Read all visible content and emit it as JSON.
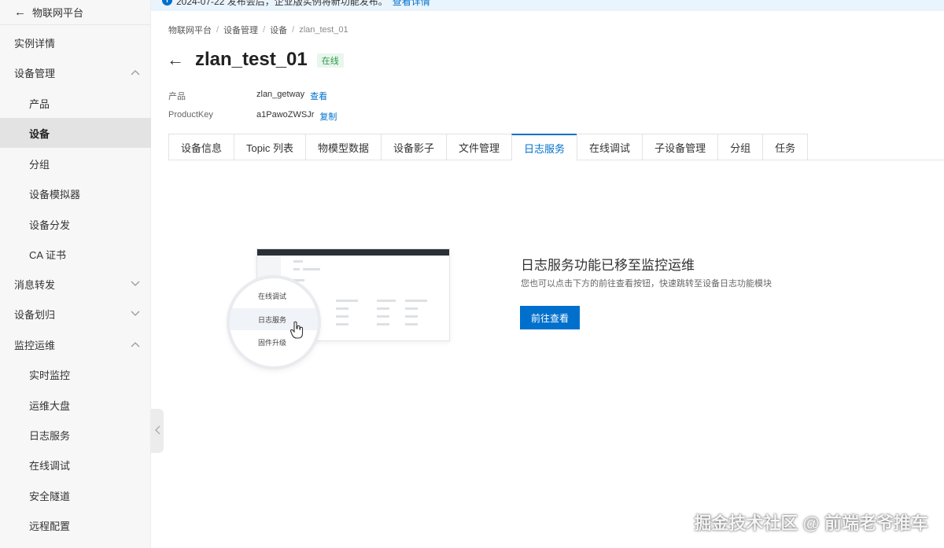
{
  "notice": {
    "text": "2024-07-22 发布会后，企业版实例将新功能发布。",
    "link": "查看详情"
  },
  "sidebar": {
    "header": "物联网平台",
    "items": [
      {
        "label": "实例详情"
      },
      {
        "label": "设备管理"
      },
      {
        "label": "产品"
      },
      {
        "label": "设备"
      },
      {
        "label": "分组"
      },
      {
        "label": "设备模拟器"
      },
      {
        "label": "设备分发"
      },
      {
        "label": "CA 证书"
      },
      {
        "label": "消息转发"
      },
      {
        "label": "设备划归"
      },
      {
        "label": "监控运维"
      },
      {
        "label": "实时监控"
      },
      {
        "label": "运维大盘"
      },
      {
        "label": "日志服务"
      },
      {
        "label": "在线调试"
      },
      {
        "label": "安全隧道"
      },
      {
        "label": "远程配置"
      }
    ]
  },
  "breadcrumb": [
    "物联网平台",
    "设备管理",
    "设备",
    "zlan_test_01"
  ],
  "page": {
    "title": "zlan_test_01",
    "status": "在线",
    "product_label": "产品",
    "product_value": "zlan_getway",
    "product_link": "查看",
    "key_label": "ProductKey",
    "key_value": "a1PawoZWSJr",
    "key_link": "复制"
  },
  "tabs": [
    "设备信息",
    "Topic 列表",
    "物模型数据",
    "设备影子",
    "文件管理",
    "日志服务",
    "在线调试",
    "子设备管理",
    "分组",
    "任务"
  ],
  "active_tab": "日志服务",
  "illustration": {
    "menu": [
      "在线调试",
      "日志服务",
      "固件升级"
    ]
  },
  "message": {
    "title": "日志服务功能已移至监控运维",
    "subtitle": "您也可以点击下方的前往查看按钮，快速跳转至设备日志功能模块",
    "button": "前往查看"
  },
  "watermark": "掘金技术社区 @ 前端老爷推车",
  "colors": {
    "accent": "#0070cc",
    "status_green": "#2a9a4a"
  }
}
